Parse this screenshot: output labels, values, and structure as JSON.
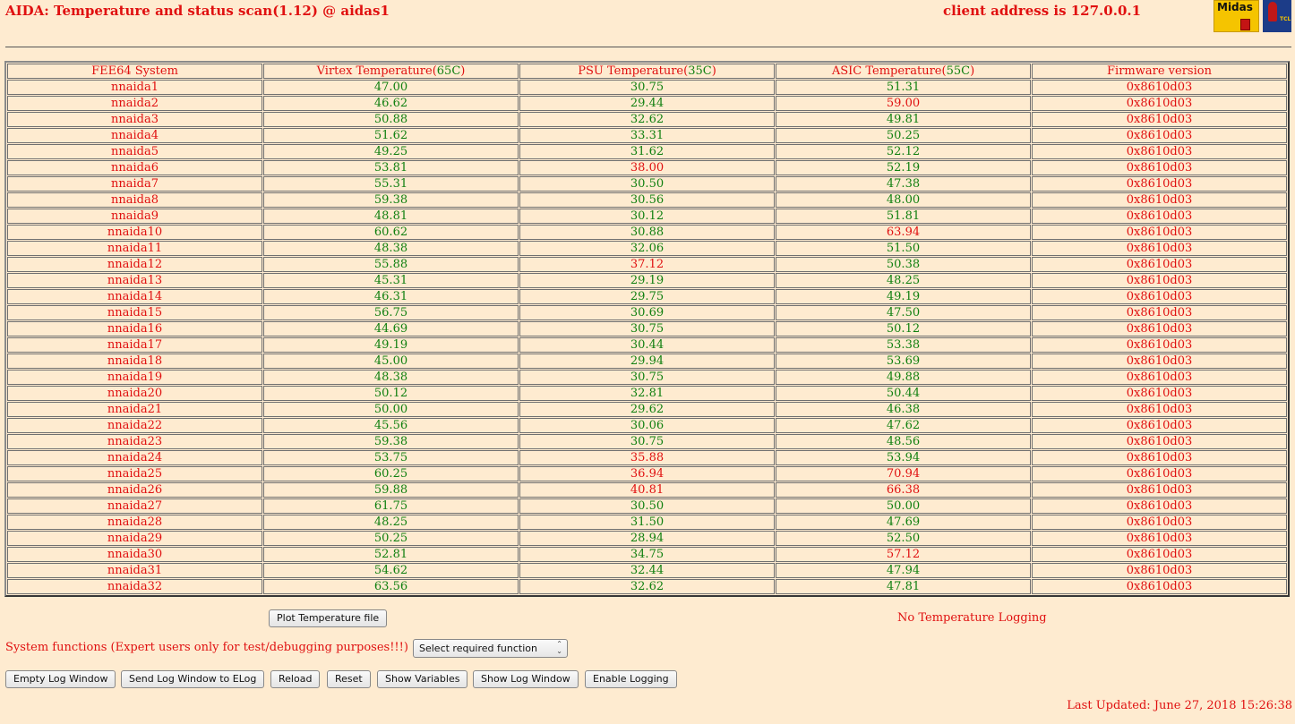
{
  "header": {
    "title": "AIDA: Temperature and status scan(1.12) @ aidas1",
    "client_address": "client address is 127.0.0.1",
    "midas_logo_text": "Midas",
    "tcl_logo_text": "TCL"
  },
  "colors": {
    "background": "#feebd0",
    "red": "#e01010",
    "green": "#108010"
  },
  "table": {
    "headers": [
      {
        "text": "FEE64 System",
        "limit": ""
      },
      {
        "text": "Virtex Temperature(",
        "limit": "65C",
        "close": ")"
      },
      {
        "text": "PSU Temperature(",
        "limit": "35C",
        "close": ")"
      },
      {
        "text": "ASIC Temperature(",
        "limit": "55C",
        "close": ")"
      },
      {
        "text": "Firmware version",
        "limit": ""
      }
    ],
    "limits": {
      "virtex": 65,
      "psu": 35,
      "asic": 55
    },
    "rows": [
      {
        "name": "nnaida1",
        "virtex": "47.00",
        "psu": "30.75",
        "asic": "51.31",
        "fw": "0x8610d03"
      },
      {
        "name": "nnaida2",
        "virtex": "46.62",
        "psu": "29.44",
        "asic": "59.00",
        "fw": "0x8610d03"
      },
      {
        "name": "nnaida3",
        "virtex": "50.88",
        "psu": "32.62",
        "asic": "49.81",
        "fw": "0x8610d03"
      },
      {
        "name": "nnaida4",
        "virtex": "51.62",
        "psu": "33.31",
        "asic": "50.25",
        "fw": "0x8610d03"
      },
      {
        "name": "nnaida5",
        "virtex": "49.25",
        "psu": "31.62",
        "asic": "52.12",
        "fw": "0x8610d03"
      },
      {
        "name": "nnaida6",
        "virtex": "53.81",
        "psu": "38.00",
        "asic": "52.19",
        "fw": "0x8610d03"
      },
      {
        "name": "nnaida7",
        "virtex": "55.31",
        "psu": "30.50",
        "asic": "47.38",
        "fw": "0x8610d03"
      },
      {
        "name": "nnaida8",
        "virtex": "59.38",
        "psu": "30.56",
        "asic": "48.00",
        "fw": "0x8610d03"
      },
      {
        "name": "nnaida9",
        "virtex": "48.81",
        "psu": "30.12",
        "asic": "51.81",
        "fw": "0x8610d03"
      },
      {
        "name": "nnaida10",
        "virtex": "60.62",
        "psu": "30.88",
        "asic": "63.94",
        "fw": "0x8610d03"
      },
      {
        "name": "nnaida11",
        "virtex": "48.38",
        "psu": "32.06",
        "asic": "51.50",
        "fw": "0x8610d03"
      },
      {
        "name": "nnaida12",
        "virtex": "55.88",
        "psu": "37.12",
        "asic": "50.38",
        "fw": "0x8610d03"
      },
      {
        "name": "nnaida13",
        "virtex": "45.31",
        "psu": "29.19",
        "asic": "48.25",
        "fw": "0x8610d03"
      },
      {
        "name": "nnaida14",
        "virtex": "46.31",
        "psu": "29.75",
        "asic": "49.19",
        "fw": "0x8610d03"
      },
      {
        "name": "nnaida15",
        "virtex": "56.75",
        "psu": "30.69",
        "asic": "47.50",
        "fw": "0x8610d03"
      },
      {
        "name": "nnaida16",
        "virtex": "44.69",
        "psu": "30.75",
        "asic": "50.12",
        "fw": "0x8610d03"
      },
      {
        "name": "nnaida17",
        "virtex": "49.19",
        "psu": "30.44",
        "asic": "53.38",
        "fw": "0x8610d03"
      },
      {
        "name": "nnaida18",
        "virtex": "45.00",
        "psu": "29.94",
        "asic": "53.69",
        "fw": "0x8610d03"
      },
      {
        "name": "nnaida19",
        "virtex": "48.38",
        "psu": "30.75",
        "asic": "49.88",
        "fw": "0x8610d03"
      },
      {
        "name": "nnaida20",
        "virtex": "50.12",
        "psu": "32.81",
        "asic": "50.44",
        "fw": "0x8610d03"
      },
      {
        "name": "nnaida21",
        "virtex": "50.00",
        "psu": "29.62",
        "asic": "46.38",
        "fw": "0x8610d03"
      },
      {
        "name": "nnaida22",
        "virtex": "45.56",
        "psu": "30.06",
        "asic": "47.62",
        "fw": "0x8610d03"
      },
      {
        "name": "nnaida23",
        "virtex": "59.38",
        "psu": "30.75",
        "asic": "48.56",
        "fw": "0x8610d03"
      },
      {
        "name": "nnaida24",
        "virtex": "53.75",
        "psu": "35.88",
        "asic": "53.94",
        "fw": "0x8610d03"
      },
      {
        "name": "nnaida25",
        "virtex": "60.25",
        "psu": "36.94",
        "asic": "70.94",
        "fw": "0x8610d03"
      },
      {
        "name": "nnaida26",
        "virtex": "59.88",
        "psu": "40.81",
        "asic": "66.38",
        "fw": "0x8610d03"
      },
      {
        "name": "nnaida27",
        "virtex": "61.75",
        "psu": "30.50",
        "asic": "50.00",
        "fw": "0x8610d03"
      },
      {
        "name": "nnaida28",
        "virtex": "48.25",
        "psu": "31.50",
        "asic": "47.69",
        "fw": "0x8610d03"
      },
      {
        "name": "nnaida29",
        "virtex": "50.25",
        "psu": "28.94",
        "asic": "52.50",
        "fw": "0x8610d03"
      },
      {
        "name": "nnaida30",
        "virtex": "52.81",
        "psu": "34.75",
        "asic": "57.12",
        "fw": "0x8610d03"
      },
      {
        "name": "nnaida31",
        "virtex": "54.62",
        "psu": "32.44",
        "asic": "47.94",
        "fw": "0x8610d03"
      },
      {
        "name": "nnaida32",
        "virtex": "63.56",
        "psu": "32.62",
        "asic": "47.81",
        "fw": "0x8610d03"
      }
    ]
  },
  "controls": {
    "plot_button": "Plot Temperature file",
    "logging_status": "No Temperature Logging",
    "system_functions_label": "System functions (Expert users only for test/debugging purposes!!!)",
    "function_select": {
      "selected": "Select required function"
    },
    "buttons": [
      "Empty Log Window",
      "Send Log Window to ELog",
      "Reload",
      "Reset",
      "Show Variables",
      "Show Log Window",
      "Enable Logging"
    ]
  },
  "footer": {
    "last_updated": "Last Updated: June 27, 2018 15:26:38"
  }
}
